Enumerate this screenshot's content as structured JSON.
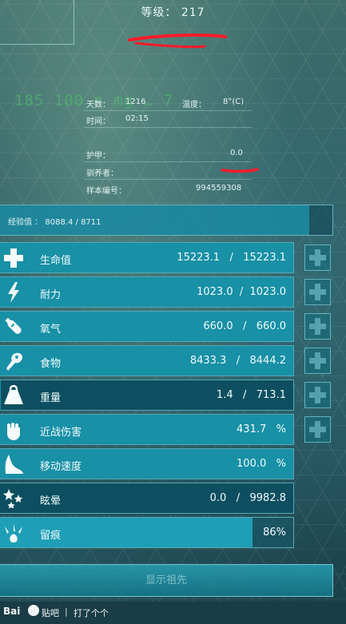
{
  "level_label": "等级： 217",
  "ghost_text": "185  100  n  mg  … 7",
  "info": {
    "days_label": "天数：",
    "days_value": "1216",
    "temp_label": "温度：",
    "temp_value": "8°(C)",
    "time_label": "时间：",
    "time_value": "02:15",
    "armor_label": "护甲：",
    "armor_value": "0.0",
    "tamer_label": "驯养者：",
    "specimen_label": "样本编号：",
    "specimen_value": "994559308"
  },
  "experience": {
    "label": "经验值",
    "current": "8088.4",
    "max": "8711",
    "text": "经验值  ：  8088.4   /   8711",
    "fill_fraction": 0.93
  },
  "stats": [
    {
      "key": "health",
      "label": "生命值",
      "value": "15223.1   /   15223.1",
      "icon": "health-cross-icon",
      "fill_fraction": 1.0,
      "has_plus": true
    },
    {
      "key": "stamina",
      "label": "耐力",
      "value": "1023.0  /  1023.0",
      "icon": "lightning-icon",
      "fill_fraction": 1.0,
      "has_plus": true
    },
    {
      "key": "oxygen",
      "label": "氧气",
      "value": "660.0   /   660.0",
      "icon": "oxygen-tank-icon",
      "fill_fraction": 1.0,
      "has_plus": true
    },
    {
      "key": "food",
      "label": "食物",
      "value": "8433.3   /   8444.2",
      "icon": "food-drumstick-icon",
      "fill_fraction": 0.999,
      "has_plus": true
    },
    {
      "key": "weight",
      "label": "重量",
      "value": "1.4   /   713.1",
      "icon": "weight-icon",
      "fill_fraction": 0.002,
      "has_plus": true
    },
    {
      "key": "melee",
      "label": "近战伤害",
      "value": "431.7   %",
      "icon": "fist-icon",
      "fill_fraction": 1.0,
      "has_plus": true
    },
    {
      "key": "speed",
      "label": "移动速度",
      "value": "100.0   %",
      "icon": "boot-icon",
      "fill_fraction": 1.0,
      "has_plus": false
    },
    {
      "key": "torpor",
      "label": "眩晕",
      "value": "0.0   /   9982.8",
      "icon": "dizzy-stars-icon",
      "fill_fraction": 0.0,
      "has_plus": false
    },
    {
      "key": "imprint",
      "label": "留痕",
      "value": "86%",
      "icon": "footprint-icon",
      "fill_fraction": 0.86,
      "has_plus": false
    }
  ],
  "ancestry_button": "显示祖先",
  "footer": {
    "logo": "Bai",
    "tieba": "贴吧",
    "separator": "|",
    "author": "打了个个"
  },
  "colors": {
    "bar_fill": "#1b9bb3",
    "bar_empty": "#0d4f60",
    "imprint_fill": "#1e9fb6",
    "scribble_red": "#ff1a2a"
  }
}
